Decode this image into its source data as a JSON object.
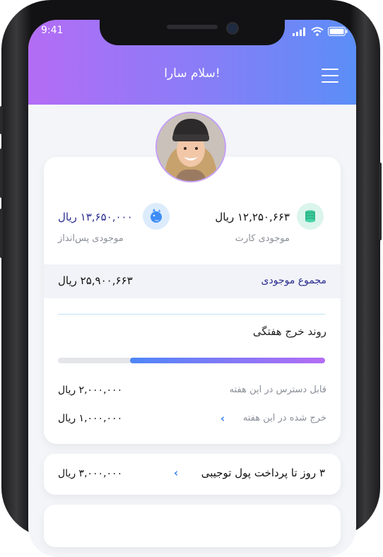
{
  "status_bar": {
    "time": "9:41"
  },
  "header": {
    "title": "سلام سارا!"
  },
  "balances": {
    "card_amount": "۱۲,۲۵۰,۶۶۳ ریال",
    "card_label": "موجودی کارت",
    "savings_amount": "۱۳,۶۵۰,۰۰۰ ریال",
    "savings_label": "موجودی پس‌انداز",
    "total_label": "مجموع موجودی",
    "total_amount": "۲۵,۹۰۰,۶۶۳ ریال"
  },
  "weekly": {
    "title": "روند خرج هفتگی",
    "progress_percent": 73,
    "available_label": "قابل دسترس در این هفته",
    "available_amount": "۲,۰۰۰,۰۰۰ ریال",
    "spent_label": "خرج شده در این هفته",
    "spent_amount": "۱,۰۰۰,۰۰۰ ریال"
  },
  "allowance": {
    "label": "۳ روز تا پرداخت پول توجیبی",
    "amount": "۳,۰۰۰,۰۰۰ ریال"
  },
  "colors": {
    "gradient_start": "#b46cf5",
    "gradient_end": "#5b8ef7",
    "accent": "#2f7ef6"
  }
}
